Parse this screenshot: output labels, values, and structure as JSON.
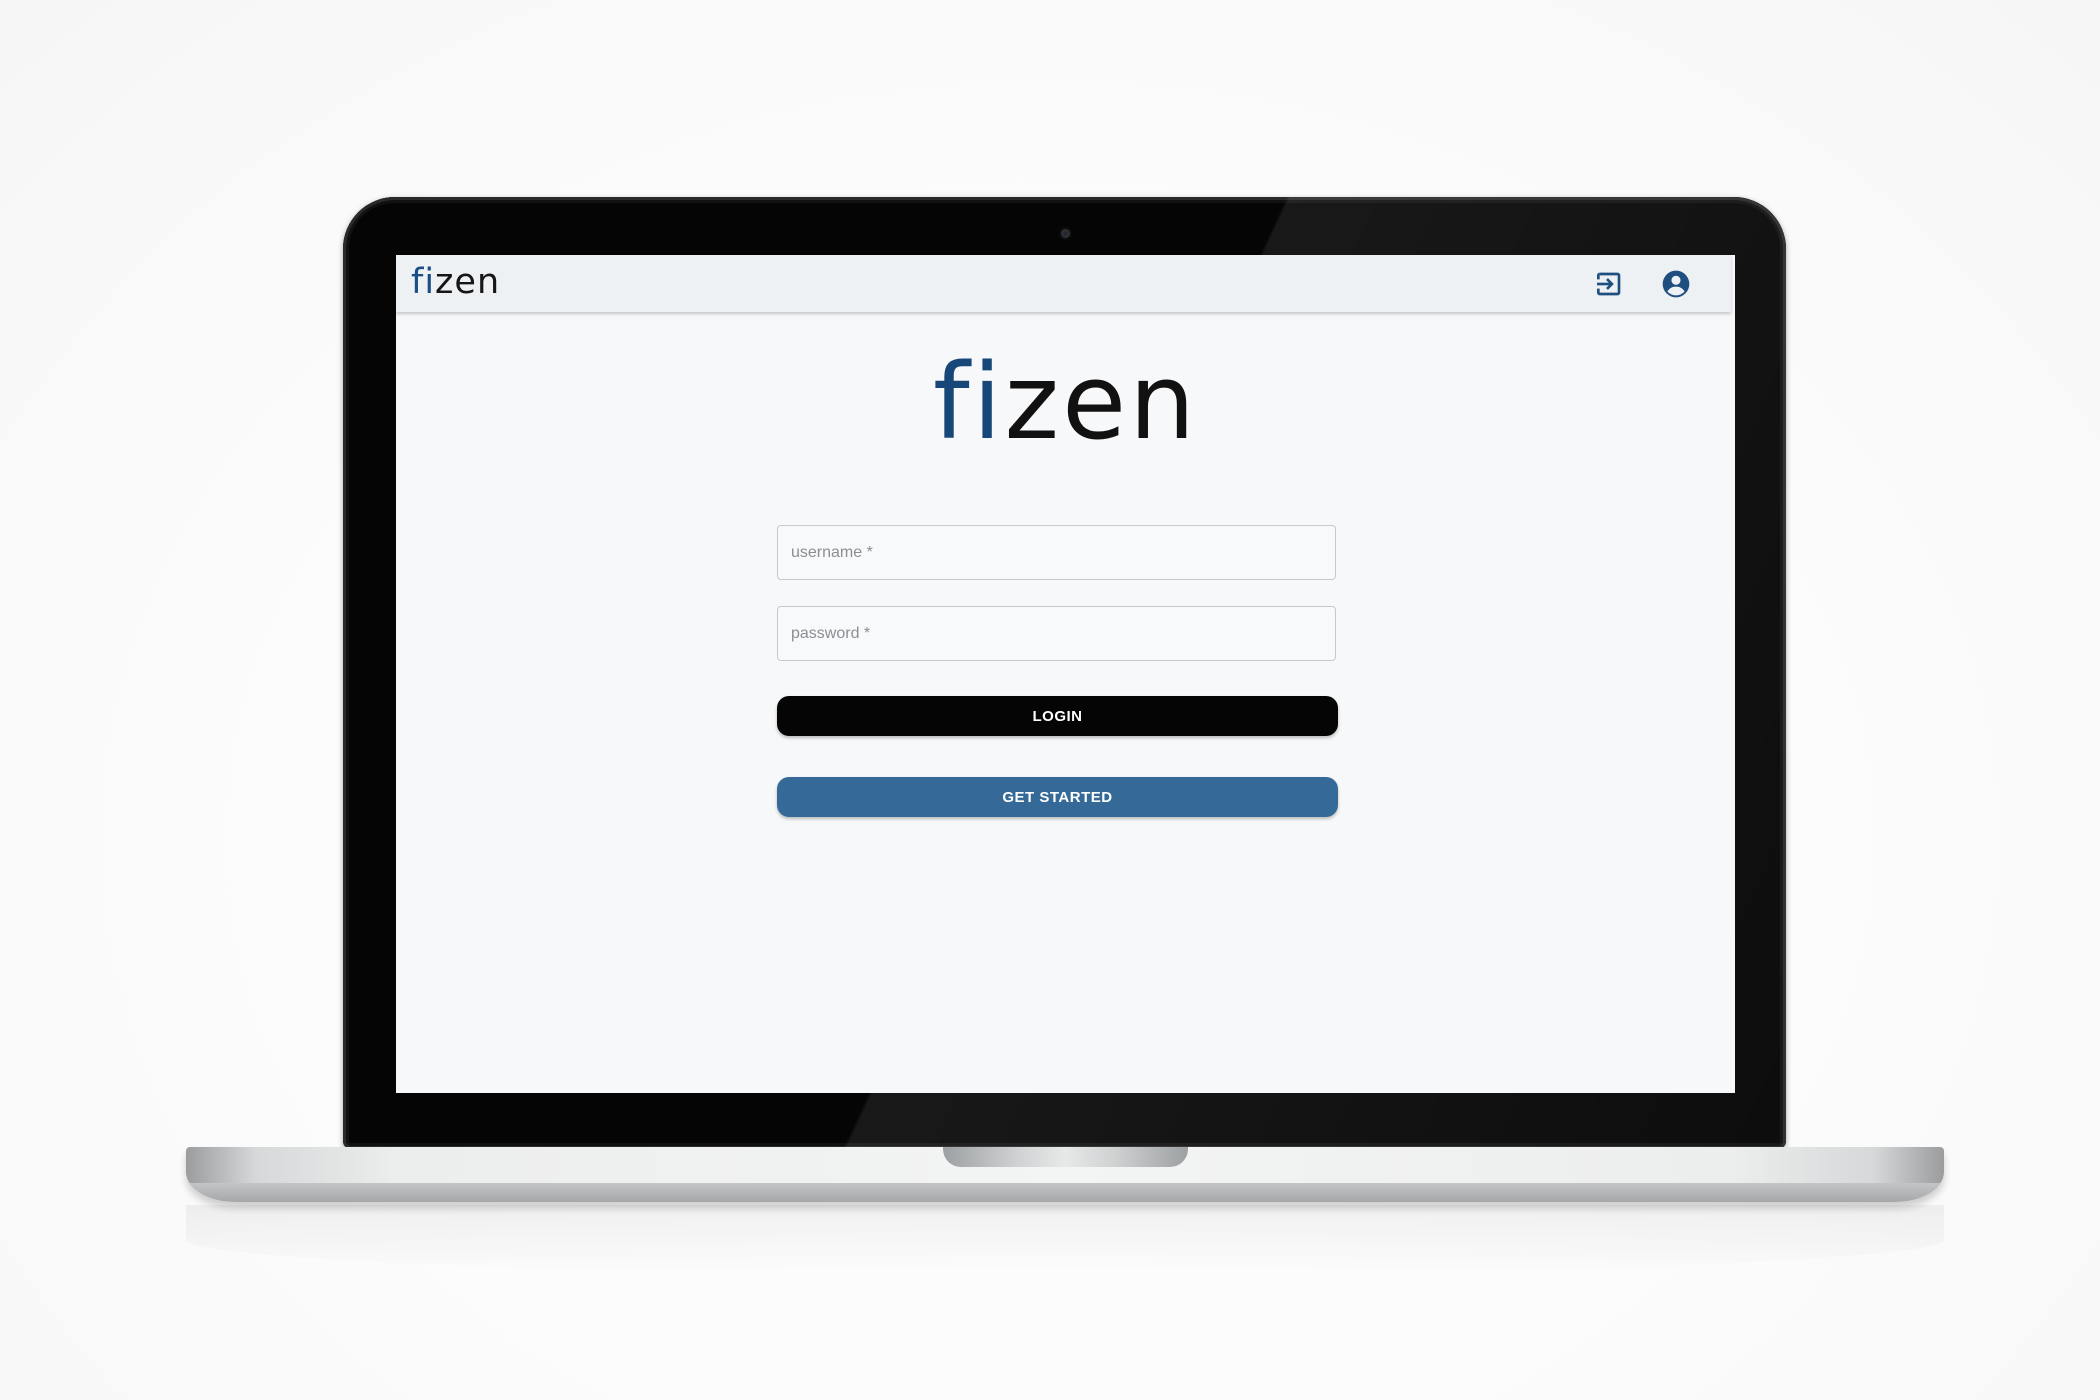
{
  "header": {
    "logo_fi": "fi",
    "logo_zen": "zen",
    "login_icon": "login-icon",
    "account_icon": "account-circle-icon"
  },
  "main": {
    "logo_fi": "fi",
    "logo_zen": "zen",
    "username_placeholder": "username *",
    "password_placeholder": "password *",
    "login_label": "LOGIN",
    "get_started_label": "GET STARTED"
  },
  "colors": {
    "brand_blue": "#1c4e85",
    "get_started_button": "#356a98",
    "login_button": "#050505",
    "icon_blue": "#1e4f80"
  }
}
